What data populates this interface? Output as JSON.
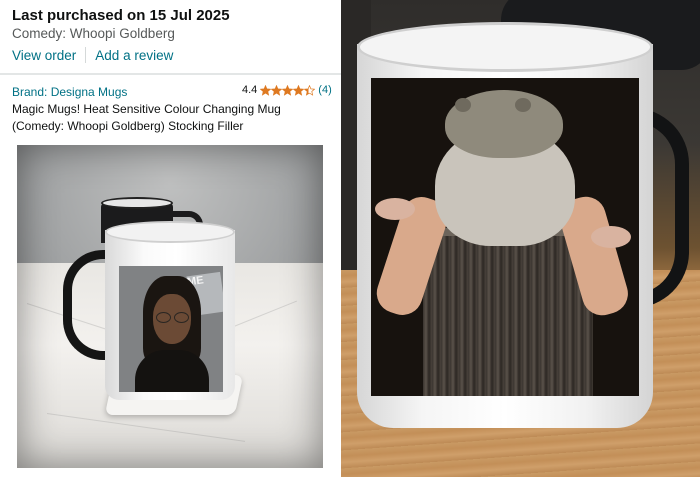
{
  "order": {
    "last_purchased": "Last purchased on 15 Jul 2025",
    "variant": "Comedy: Whoopi Goldberg",
    "view_order": "View order",
    "add_review": "Add a review"
  },
  "product": {
    "brand": "Brand: Designa Mugs",
    "rating_value": "4.4",
    "rating_stars": 4.4,
    "rating_count": "(4)",
    "title": "Magic Mugs! Heat Sensitive Colour Changing Mug (Comedy: Whoopi Goldberg) Stocking Filler",
    "mugshot_sign": "ME"
  },
  "colors": {
    "link": "#007185",
    "star": "#de7921",
    "text": "#0f1111",
    "muted": "#565959"
  }
}
